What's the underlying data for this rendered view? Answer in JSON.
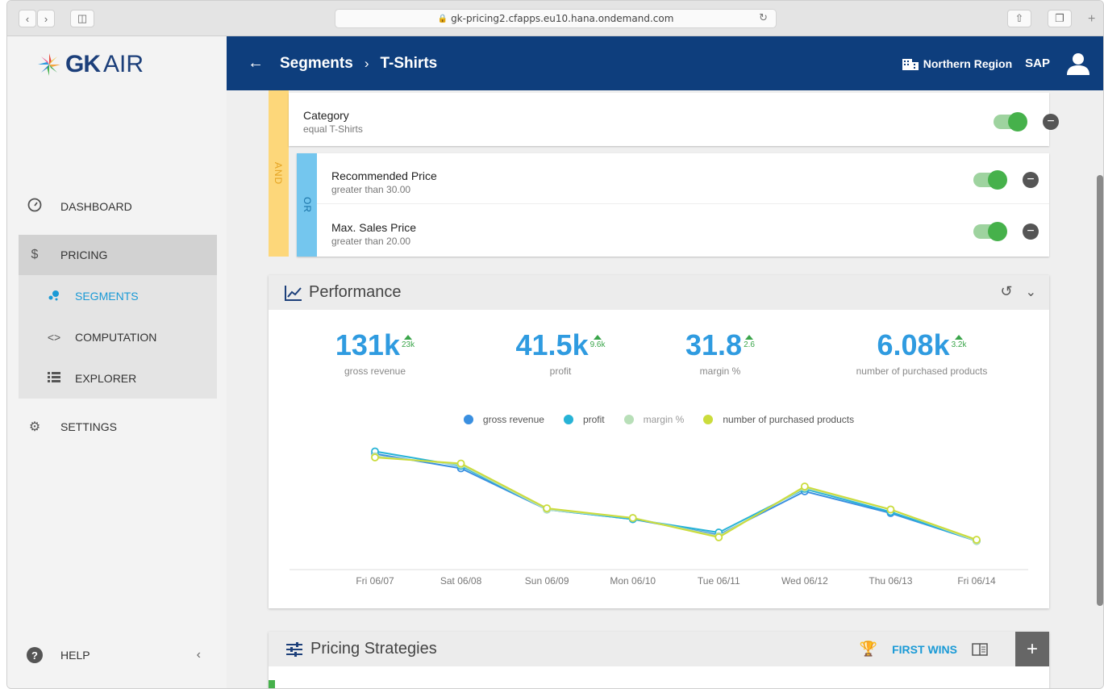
{
  "browser": {
    "url": "gk-pricing2.cfapps.eu10.hana.ondemand.com"
  },
  "sidebar": {
    "logo_bold": "GK",
    "logo_light": "AIR",
    "items": [
      {
        "label": "DASHBOARD",
        "icon": "gauge-icon"
      },
      {
        "label": "PRICING",
        "icon": "dollar-icon"
      },
      {
        "label": "SEGMENTS",
        "icon": "segments-icon"
      },
      {
        "label": "COMPUTATION",
        "icon": "code-icon"
      },
      {
        "label": "EXPLORER",
        "icon": "list-icon"
      },
      {
        "label": "SETTINGS",
        "icon": "gear-icon"
      }
    ],
    "help_label": "HELP",
    "help_icon": "?"
  },
  "header": {
    "crumb1": "Segments",
    "crumb2": "T-Shirts",
    "region": "Northern Region",
    "company": "SAP"
  },
  "conditions": {
    "and_label": "AND",
    "or_label": "OR",
    "rows": [
      {
        "title": "Category",
        "sub": "equal T-Shirts"
      },
      {
        "title": "Recommended Price",
        "sub": "greater than 30.00"
      },
      {
        "title": "Max. Sales Price",
        "sub": "greater than 20.00"
      }
    ]
  },
  "performance": {
    "title": "Performance",
    "kpis": [
      {
        "value": "131k",
        "delta": "23k",
        "label": "gross revenue"
      },
      {
        "value": "41.5k",
        "delta": "9.6k",
        "label": "profit"
      },
      {
        "value": "31.8",
        "delta": "2.6",
        "label": "margin %"
      },
      {
        "value": "6.08k",
        "delta": "3.2k",
        "label": "number of purchased products"
      }
    ]
  },
  "chart_data": {
    "type": "line",
    "categories": [
      "Fri 06/07",
      "Sat 06/08",
      "Sun 06/09",
      "Mon 06/10",
      "Tue 06/11",
      "Wed 06/12",
      "Thu 06/13",
      "Fri 06/14"
    ],
    "series": [
      {
        "name": "gross revenue",
        "color": "#3a8fe0",
        "values": [
          0.89,
          0.77,
          0.43,
          0.35,
          0.22,
          0.58,
          0.4,
          0.17
        ]
      },
      {
        "name": "profit",
        "color": "#27b3d6",
        "values": [
          0.91,
          0.79,
          0.43,
          0.35,
          0.24,
          0.6,
          0.41,
          0.17
        ]
      },
      {
        "name": "margin %",
        "color": "#b8dfb8",
        "values": [
          0.87,
          0.8,
          0.43,
          0.36,
          0.21,
          0.61,
          0.43,
          0.17
        ]
      },
      {
        "name": "number of purchased products",
        "color": "#cbdc3c",
        "values": [
          0.86,
          0.81,
          0.44,
          0.36,
          0.2,
          0.62,
          0.43,
          0.18
        ]
      }
    ],
    "grid": false,
    "legend": "top-center"
  },
  "pricing_strategies": {
    "title": "Pricing Strategies",
    "mode": "FIRST WINS"
  }
}
